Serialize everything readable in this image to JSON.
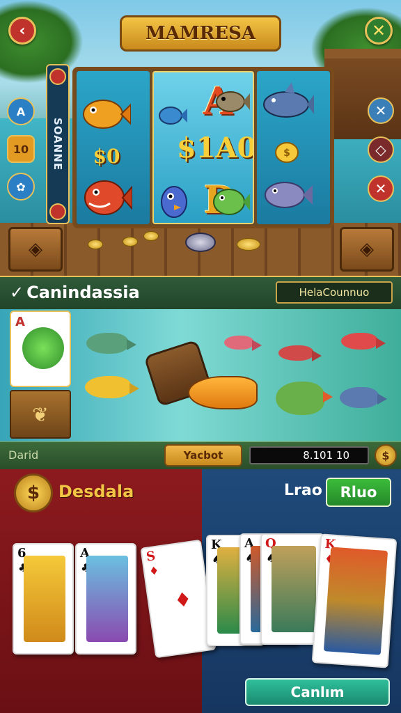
{
  "header": {
    "back_icon": "‹",
    "close_icon": "✕",
    "logo_text": "MAMRESA"
  },
  "left_side": {
    "chip_a": "A",
    "chip_number": "10",
    "chip_symbol": "✿"
  },
  "strip": {
    "vertical_text": "SOANNE"
  },
  "reels": {
    "col1_amount": "$0",
    "mid_letter_top": "A",
    "mid_win_amount": "$1A0",
    "mid_letter_bottom": "D"
  },
  "right_side": {
    "btn1_icon": "✕",
    "btn2_icon": "◇",
    "btn3_icon": "✕"
  },
  "fishing": {
    "title": "Canindassia",
    "input_value": "HelaCounnuo",
    "side_card_rank": "A",
    "footer_label": "Darid",
    "ticket_button": "Yacbot",
    "balance": "8.101 10",
    "coin_icon": "$"
  },
  "table": {
    "dealer_icon": "$",
    "dealer_label": "Desdala",
    "player_label": "Lrao",
    "player_button": "Rluo",
    "continue_button": "Canlım",
    "dealer_cards": [
      {
        "rank": "6",
        "suit": "♣"
      },
      {
        "rank": "A",
        "suit": "♣"
      }
    ],
    "player_cards": [
      {
        "rank": "S",
        "suit": "♦"
      },
      {
        "rank": "K",
        "suit": "♠"
      },
      {
        "rank": "A",
        "suit": "♠"
      },
      {
        "rank": "Q",
        "suit": "♠"
      },
      {
        "rank": "K",
        "suit": "♦"
      }
    ]
  }
}
